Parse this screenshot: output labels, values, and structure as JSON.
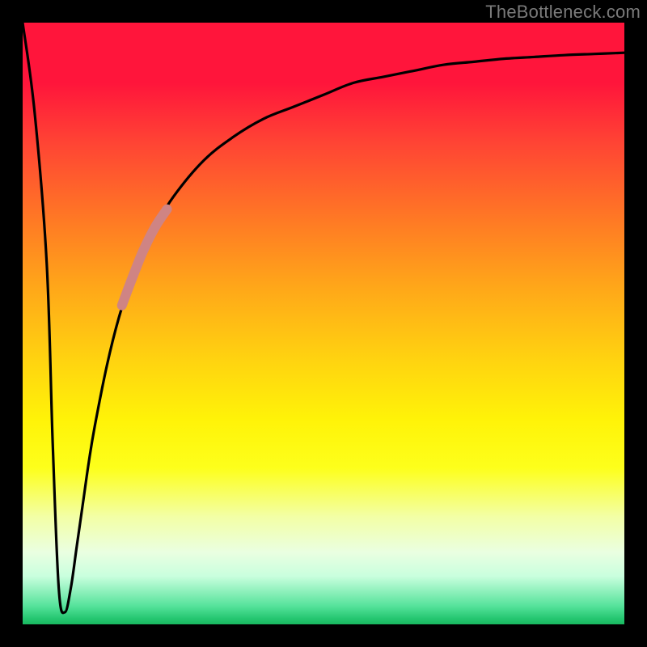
{
  "watermark": "TheBottleneck.com",
  "chart_data": {
    "type": "line",
    "title": "",
    "xlabel": "",
    "ylabel": "",
    "xlim": [
      0,
      100
    ],
    "ylim": [
      0,
      100
    ],
    "series": [
      {
        "name": "bottleneck-curve",
        "x": [
          0,
          2,
          4,
          5,
          6,
          7,
          8,
          9,
          10,
          11,
          12,
          14,
          16,
          18,
          20,
          22,
          25,
          30,
          35,
          40,
          45,
          50,
          55,
          60,
          65,
          70,
          75,
          80,
          85,
          90,
          95,
          100
        ],
        "values": [
          100,
          85,
          60,
          30,
          6,
          2,
          6,
          13,
          20,
          27,
          33,
          43,
          51,
          57,
          62,
          66,
          71,
          77,
          81,
          84,
          86,
          88,
          90,
          91,
          92,
          93,
          93.5,
          94,
          94.3,
          94.6,
          94.8,
          95
        ]
      },
      {
        "name": "highlight-segment",
        "x": [
          16.5,
          18,
          20,
          22,
          24
        ],
        "values": [
          53,
          57,
          62,
          66,
          69
        ]
      }
    ],
    "annotations": []
  },
  "colors": {
    "curve": "#000000",
    "highlight": "#cf8484",
    "watermark": "#7a7a7a",
    "frame_bg": "#000000"
  }
}
